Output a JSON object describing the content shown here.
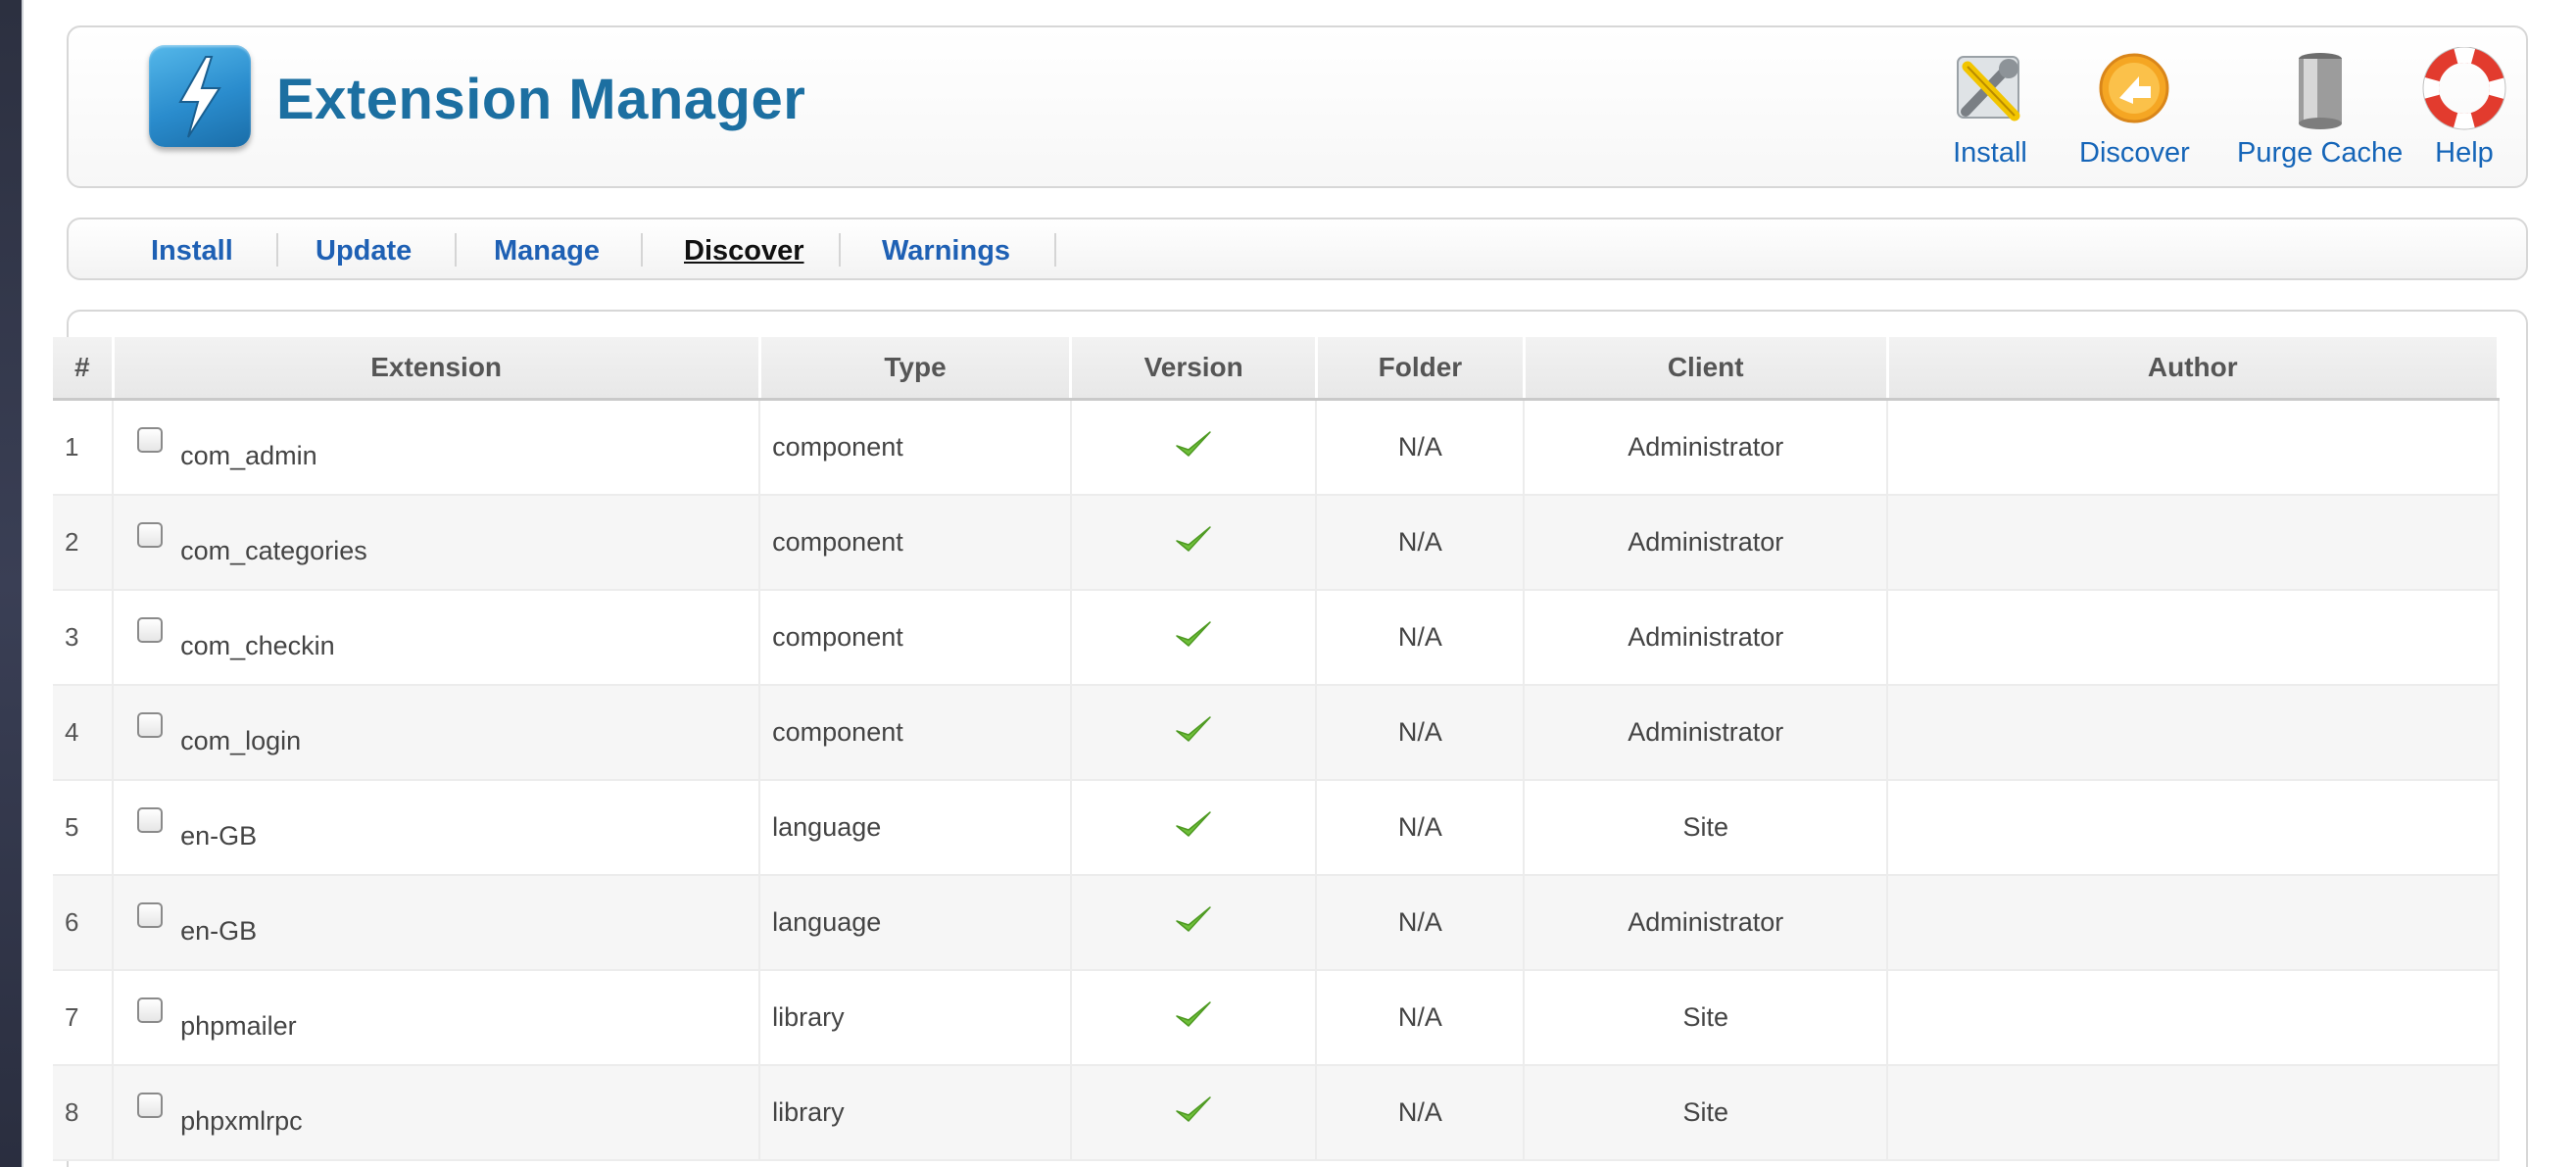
{
  "header": {
    "title": "Extension Manager",
    "toolbar": [
      {
        "label": "Install",
        "icon": "install-tools-icon"
      },
      {
        "label": "Discover",
        "icon": "discover-arrow-icon"
      },
      {
        "label": "Purge Cache",
        "icon": "trash-can-icon"
      },
      {
        "label": "Help",
        "icon": "lifebuoy-help-icon"
      }
    ]
  },
  "submenu": {
    "items": [
      {
        "label": "Install",
        "active": false
      },
      {
        "label": "Update",
        "active": false
      },
      {
        "label": "Manage",
        "active": false
      },
      {
        "label": "Discover",
        "active": true
      },
      {
        "label": "Warnings",
        "active": false
      }
    ]
  },
  "table": {
    "columns": [
      "#",
      "Extension",
      "Type",
      "Version",
      "Folder",
      "Client",
      "Author"
    ],
    "rows": [
      {
        "num": "1",
        "extension": "com_admin",
        "type": "component",
        "folder": "N/A",
        "client": "Administrator",
        "author": ""
      },
      {
        "num": "2",
        "extension": "com_categories",
        "type": "component",
        "folder": "N/A",
        "client": "Administrator",
        "author": ""
      },
      {
        "num": "3",
        "extension": "com_checkin",
        "type": "component",
        "folder": "N/A",
        "client": "Administrator",
        "author": ""
      },
      {
        "num": "4",
        "extension": "com_login",
        "type": "component",
        "folder": "N/A",
        "client": "Administrator",
        "author": ""
      },
      {
        "num": "5",
        "extension": "en-GB",
        "type": "language",
        "folder": "N/A",
        "client": "Site",
        "author": ""
      },
      {
        "num": "6",
        "extension": "en-GB",
        "type": "language",
        "folder": "N/A",
        "client": "Administrator",
        "author": ""
      },
      {
        "num": "7",
        "extension": "phpmailer",
        "type": "library",
        "folder": "N/A",
        "client": "Site",
        "author": ""
      },
      {
        "num": "8",
        "extension": "phpxmlrpc",
        "type": "library",
        "folder": "N/A",
        "client": "Site",
        "author": ""
      }
    ]
  },
  "colors": {
    "title": "#1c6fa1",
    "link": "#1e60b4",
    "check_green": "#6fbf3a"
  }
}
